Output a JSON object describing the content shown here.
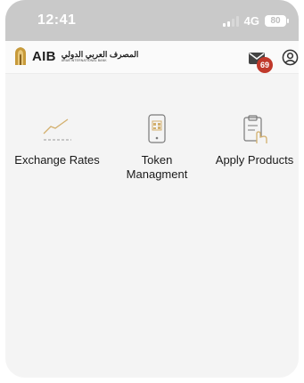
{
  "status": {
    "time": "12:41",
    "network": "4G",
    "battery": "80"
  },
  "header": {
    "logo_text": "AIB",
    "logo_arabic": "المصرف العربي الدولي",
    "logo_english": "ARAB INTERNATIONAL BANK",
    "notifications_count": "69"
  },
  "menu": {
    "items": [
      {
        "label": "Exchange Rates",
        "icon": "chart-line-icon"
      },
      {
        "label": "Token Managment",
        "icon": "phone-token-icon"
      },
      {
        "label": "Apply Products",
        "icon": "clipboard-hand-icon"
      }
    ]
  },
  "colors": {
    "statusbar": "#c9c9c9",
    "badge": "#c0392b",
    "icon_gold": "#d3b06e"
  }
}
